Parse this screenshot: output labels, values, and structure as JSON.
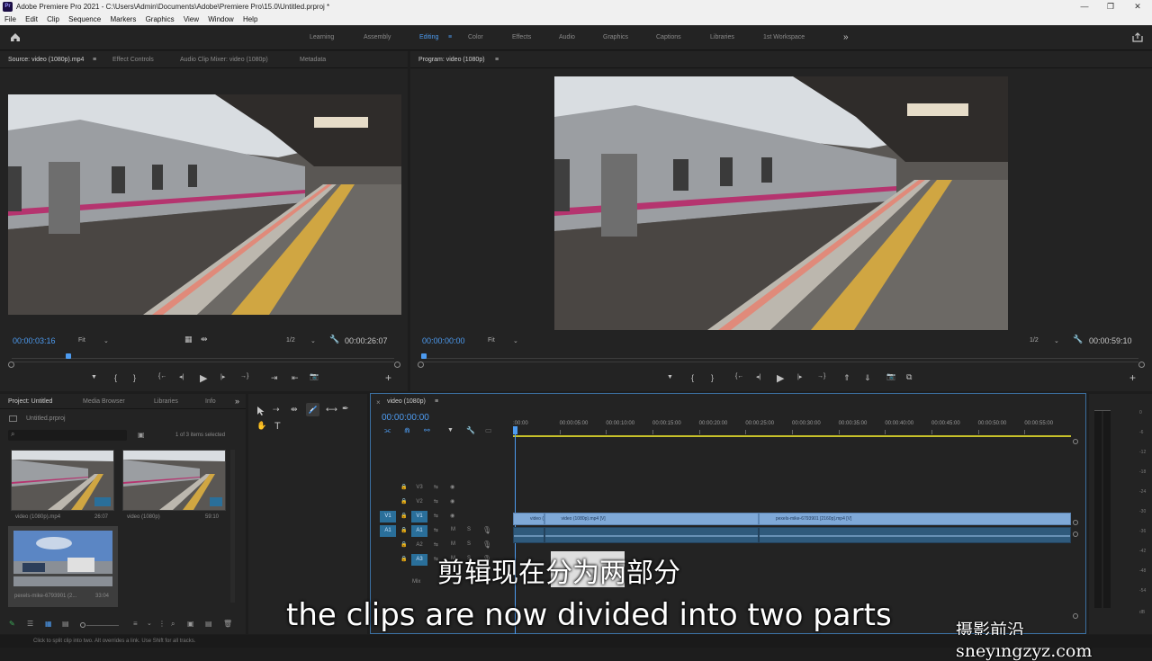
{
  "window": {
    "title": "Adobe Premiere Pro 2021 - C:\\Users\\Admin\\Documents\\Adobe\\Premiere Pro\\15.0\\Untitled.prproj *",
    "logo": "Pr"
  },
  "menu": [
    "File",
    "Edit",
    "Clip",
    "Sequence",
    "Markers",
    "Graphics",
    "View",
    "Window",
    "Help"
  ],
  "workspaces": {
    "items": [
      "Learning",
      "Assembly",
      "Editing",
      "Color",
      "Effects",
      "Audio",
      "Graphics",
      "Captions",
      "Libraries",
      "1st Workspace"
    ],
    "active": "Editing",
    "overflow": "»"
  },
  "source": {
    "tabs": [
      "Source: video (1080p).mp4",
      "Effect Controls",
      "Audio Clip Mixer: video (1080p)",
      "Metadata"
    ],
    "menu_glyph": "≡",
    "timecode": "00:00:03:16",
    "fit": "Fit",
    "resolution": "1/2",
    "duration": "00:00:26:07",
    "playhead_fraction": 0.14
  },
  "program": {
    "tab": "Program: video (1080p)",
    "menu_glyph": "≡",
    "timecode": "00:00:00:00",
    "fit": "Fit",
    "resolution": "1/2",
    "duration": "00:00:59:10",
    "playhead_fraction": 0.0
  },
  "transport_glyphs": {
    "marker": "▼",
    "in": "{",
    "out": "}",
    "goto_in": "{←",
    "step_back": "◂|",
    "play": "▶",
    "step_fwd": "|▸",
    "goto_out": "→}",
    "insert": "⇥",
    "overwrite": "⇤",
    "export": "📷",
    "add": "+"
  },
  "project": {
    "tabs": [
      "Project: Untitled",
      "Media Browser",
      "Libraries",
      "Info"
    ],
    "overflow": "»",
    "file": "Untitled.prproj",
    "items_selected": "1 of 3 items selected",
    "items": [
      {
        "name": "video (1080p).mp4",
        "duration": "26:07"
      },
      {
        "name": "video (1080p)",
        "duration": "59:10"
      },
      {
        "name": "pexels-mike-6793901 (2...",
        "duration": "33:04"
      }
    ]
  },
  "tools": {
    "icons": [
      "selection-tool-icon",
      "track-select-icon",
      "ripple-edit-icon",
      "razor-icon",
      "slip-icon",
      "pen-icon",
      "hand-icon",
      "type-icon"
    ],
    "type_glyph": "T"
  },
  "timeline": {
    "tab": "video (1080p)",
    "menu_glyph": "≡",
    "close_glyph": "×",
    "timecode": "00:00:00:00",
    "ruler": [
      ":00:00",
      "00:00:05:00",
      "00:00:10:00",
      "00:00:15:00",
      "00:00:20:00",
      "00:00:25:00",
      "00:00:30:00",
      "00:00:35:00",
      "00:00:40:00",
      "00:00:45:00",
      "00:00:50:00",
      "00:00:55:00"
    ],
    "tracks": [
      {
        "src": "",
        "name": "V3",
        "kind": "video"
      },
      {
        "src": "",
        "name": "V2",
        "kind": "video"
      },
      {
        "src": "V1",
        "name": "V1",
        "kind": "video"
      },
      {
        "src": "A1",
        "name": "A1",
        "kind": "audio",
        "m": "M",
        "s": "S"
      },
      {
        "src": "",
        "name": "A2",
        "kind": "audio",
        "m": "M",
        "s": "S"
      },
      {
        "src": "",
        "name": "A3",
        "kind": "audio",
        "m": "M",
        "s": "S"
      }
    ],
    "mix_label": "Mix",
    "clips": [
      {
        "label": "video (1080p).mp",
        "start": 0.0,
        "end": 3.3
      },
      {
        "label": "video (1080p).mp4 [V]",
        "start": 3.3,
        "end": 26.1
      },
      {
        "label": "pexels-mike-6793901 [2160p].mp4 [V]",
        "start": 26.1,
        "end": 59.3
      }
    ],
    "total_seconds": 59.3
  },
  "meter": {
    "labels": [
      "0",
      "-6",
      "-12",
      "-18",
      "-24",
      "-30",
      "-36",
      "-42",
      "-48",
      "-54"
    ],
    "db_label": "dB"
  },
  "subtitles": {
    "chinese": "剪辑现在分为两部分",
    "english": "the clips are now divided into two parts"
  },
  "watermark": "摄影前沿 sheyingzyz.com",
  "status": "Click to split clip into two. Alt overrides a link. Use Shift for all tracks.",
  "colors": {
    "accent": "#4d9bf0",
    "clip_video": "#7fa9d8",
    "clip_audio": "#2f5a7c",
    "track_target": "#2a6f9a"
  }
}
